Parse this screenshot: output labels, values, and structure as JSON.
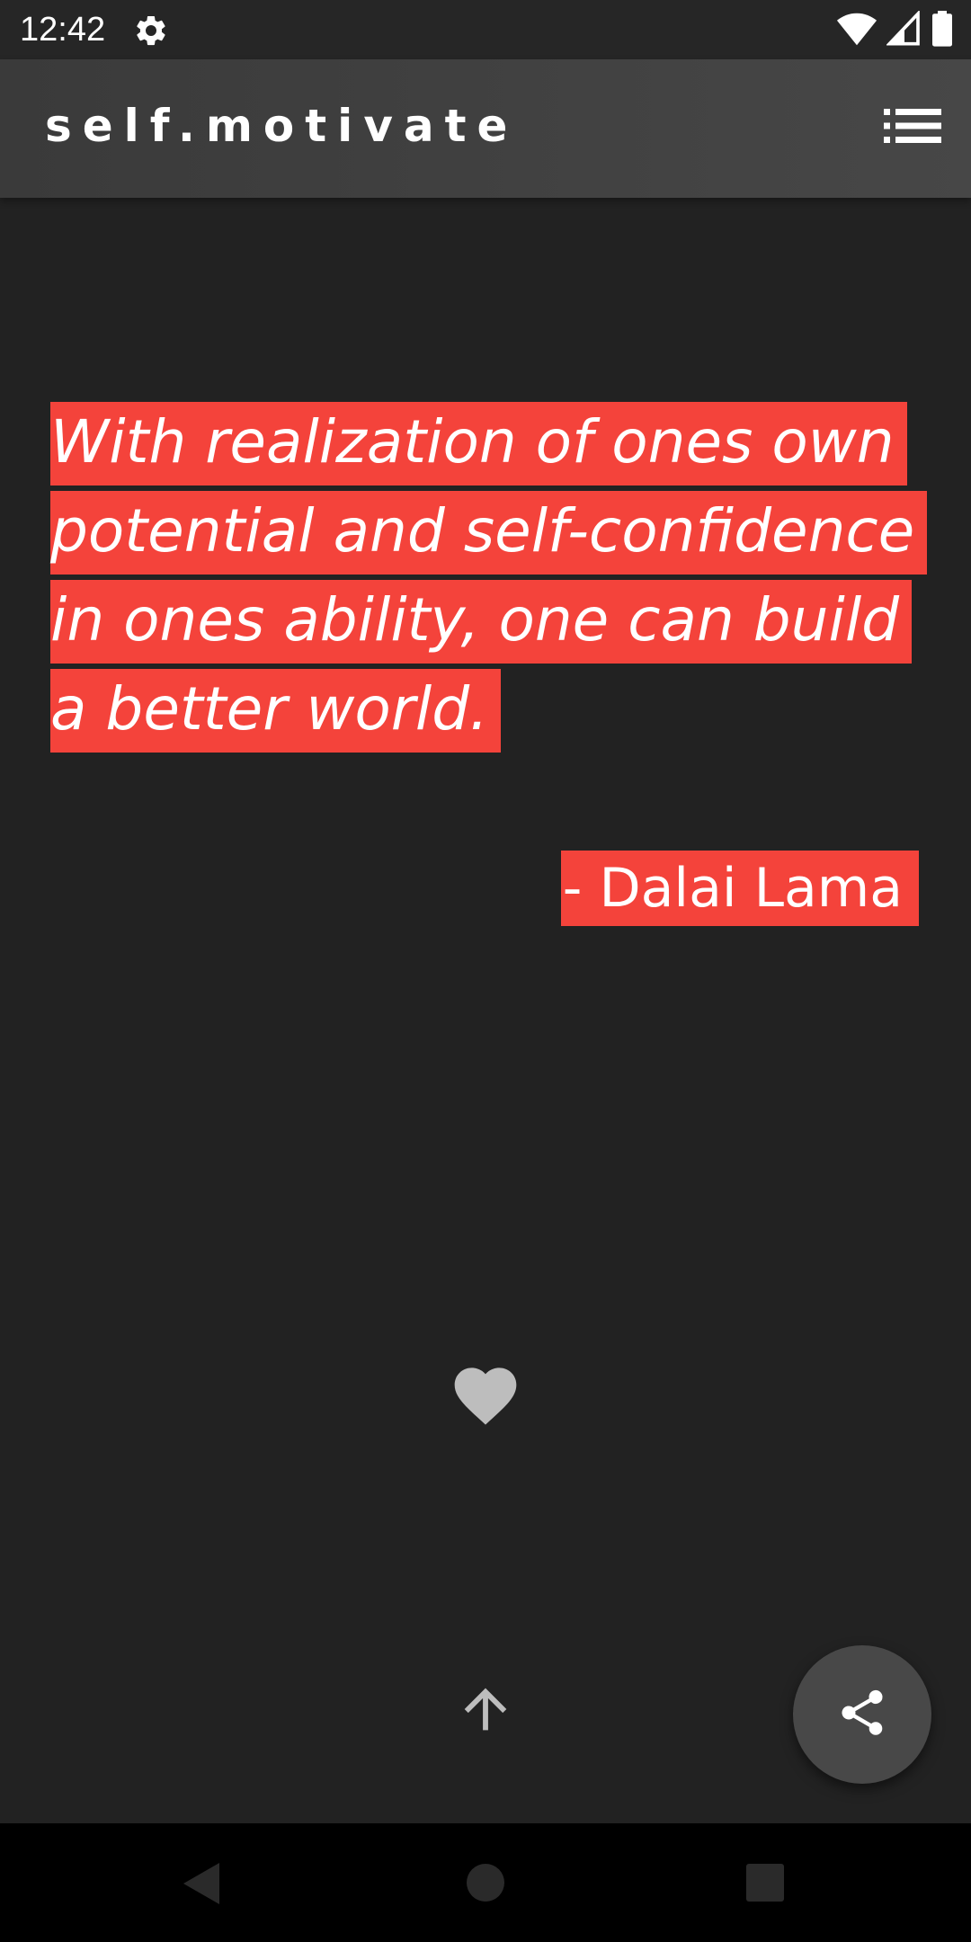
{
  "status_bar": {
    "time": "12:42",
    "icons": [
      "settings-icon",
      "wifi-icon",
      "signal-icon",
      "battery-icon"
    ]
  },
  "app_bar": {
    "title": "self.motivate",
    "menu_icon": "list-icon"
  },
  "quote": {
    "text": "With realization of ones own potential and self-confidence in ones ability, one can build a better world.",
    "author": "- Dalai Lama",
    "highlight_color": "#f4433b"
  },
  "actions": {
    "favorite_icon": "heart-icon",
    "scroll_up_icon": "arrow-up-icon",
    "share_icon": "share-icon"
  },
  "nav_bar": {
    "icons": [
      "back-icon",
      "home-icon",
      "recents-icon"
    ]
  },
  "colors": {
    "background": "#222222",
    "app_bar": "#444444",
    "accent": "#f4433b",
    "fab": "#484848",
    "icon_gray": "#bdbdbd"
  }
}
